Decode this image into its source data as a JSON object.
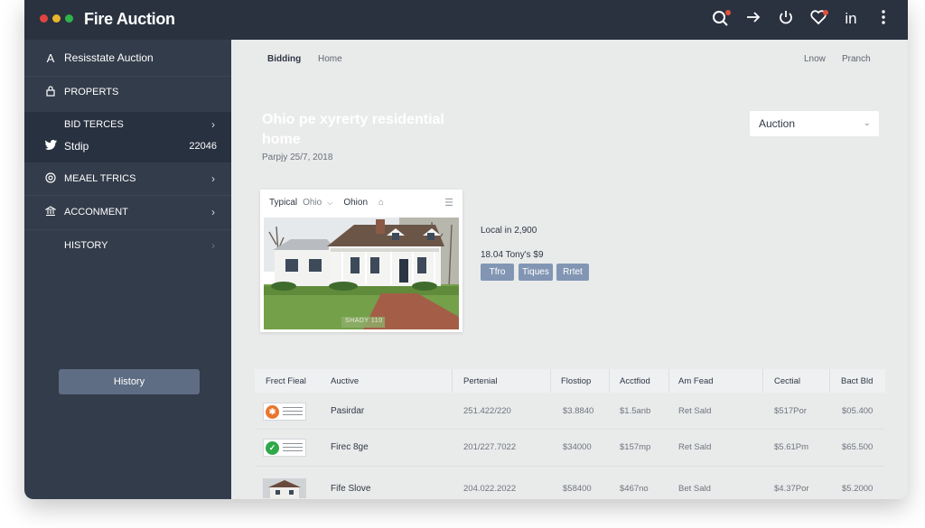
{
  "app": {
    "title": "Fire Auction",
    "traffic_lights": [
      "#e0443e",
      "#e9b52c",
      "#2fb34a"
    ]
  },
  "toolbar": {
    "icons": [
      "search-icon",
      "arrow-right-icon",
      "power-icon",
      "heart-icon",
      "linkedin-icon",
      "more-vertical-icon"
    ],
    "linkedin_label": "in"
  },
  "sidebar": {
    "header": {
      "icon_text": "A",
      "label": "Resisstate Auction"
    },
    "items": [
      {
        "label": "PROPERTS"
      },
      {
        "label": "BID TERCES"
      },
      {
        "label": "Stdip",
        "value": "22046"
      },
      {
        "label": "MEAEL TFRICS"
      },
      {
        "label": "ACCONMENT"
      },
      {
        "label": "HISTORY"
      }
    ],
    "button_label": "History"
  },
  "main": {
    "tabs": [
      "Bidding",
      "Home"
    ],
    "header_links": [
      "Lnow",
      "Pranch"
    ],
    "property_title": "Ohio pe xyrerty residential home",
    "date": "Parpjy 25/7, 2018",
    "select_value": "Auction",
    "card": {
      "label": "Typical",
      "location": "Ohio",
      "location2": "Ohion",
      "photo_sign": "SHADY 110"
    },
    "info": [
      "Local in 2,900",
      "18.04 Tony's $9"
    ],
    "tags": [
      "Tfro",
      "Tiques",
      "Rrtet"
    ],
    "table": {
      "headers": [
        "Frect Fieal",
        "Auctive",
        "Pertenial",
        "Flostiop",
        "Acctfiod",
        "Am Fead",
        "Cectial",
        "Bact Bld"
      ],
      "rows": [
        {
          "thumb": "logo-orange",
          "name": "Pasirdar",
          "pertenial": "251.422/220",
          "flostiop": "$3.8840",
          "acctfiod": "$1.5anb",
          "amfead": "Ret Sald",
          "cectial": "$517Por",
          "bactbld": "$05.400"
        },
        {
          "thumb": "logo-green",
          "name": "Firec 8ge",
          "pertenial": "201/227.7022",
          "flostiop": "$34000",
          "acctfiod": "$157mp",
          "amfead": "Ret Sald",
          "cectial": "$5.61Pm",
          "bactbld": "$65.500"
        },
        {
          "thumb": "house-photo",
          "name": "Fife Slove",
          "pertenial": "204.022.2022",
          "flostiop": "$58400",
          "acctfiod": "$467no",
          "amfead": "Bet Sald",
          "cectial": "$4.37Por",
          "bactbld": "$5.2000"
        }
      ]
    }
  }
}
